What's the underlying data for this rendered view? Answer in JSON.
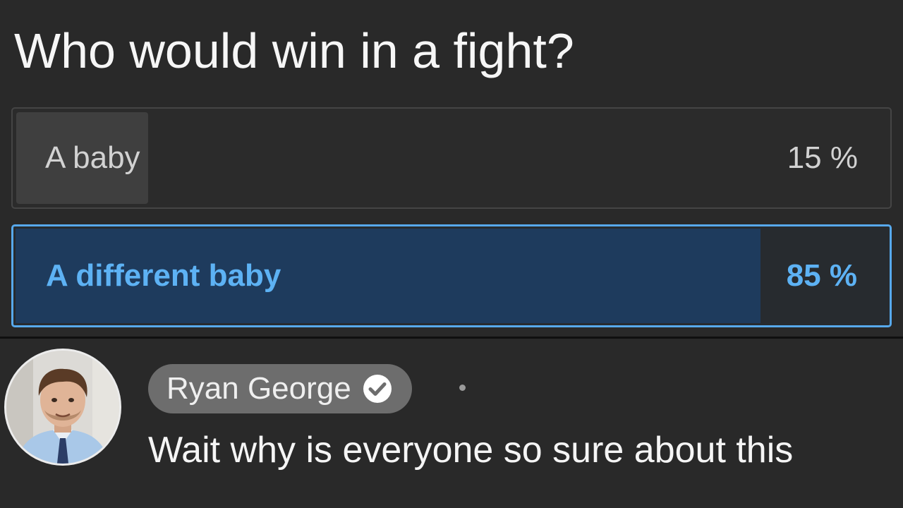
{
  "poll": {
    "question": "Who would win in a fight?",
    "options": [
      {
        "label": "A baby",
        "percent_label": "15 %",
        "share": 0.15,
        "selected": false
      },
      {
        "label": "A different baby",
        "percent_label": "85 %",
        "share": 0.85,
        "selected": true
      }
    ]
  },
  "comment": {
    "author": "Ryan George",
    "verified": true,
    "text": "Wait why is everyone so sure about this"
  },
  "icons": {
    "verified": "check-circle-icon",
    "avatar": "user-photo-avatar"
  },
  "colors": {
    "background": "#292929",
    "accent": "#57a9ec",
    "selected_fill": "#1e3b5d",
    "unselected_fill": "#3f3f3f",
    "chip": "#6d6d6d"
  }
}
